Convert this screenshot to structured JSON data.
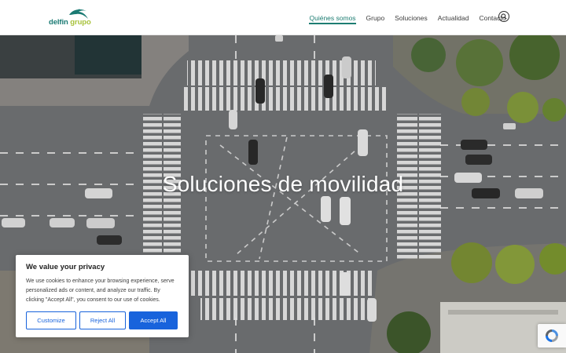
{
  "header": {
    "logo": {
      "word1": "delfin",
      "word2": "grupo"
    },
    "nav": [
      {
        "label": "Quiénes somos",
        "active": true
      },
      {
        "label": "Grupo"
      },
      {
        "label": "Soluciones"
      },
      {
        "label": "Actualidad"
      },
      {
        "label": "Contacto"
      }
    ],
    "search_icon": "search-icon"
  },
  "hero": {
    "title": "Soluciones de movilidad"
  },
  "cookie": {
    "title": "We value your privacy",
    "text": "We use cookies to enhance your browsing experience, serve personalized ads or content, and analyze our traffic. By clicking \"Accept All\", you consent to our use of cookies.",
    "buttons": {
      "customize": "Customize",
      "reject": "Reject All",
      "accept": "Accept All"
    }
  },
  "colors": {
    "brand_teal": "#1d7d72",
    "brand_green": "#a8c23b",
    "cookie_blue": "#1863dc"
  }
}
